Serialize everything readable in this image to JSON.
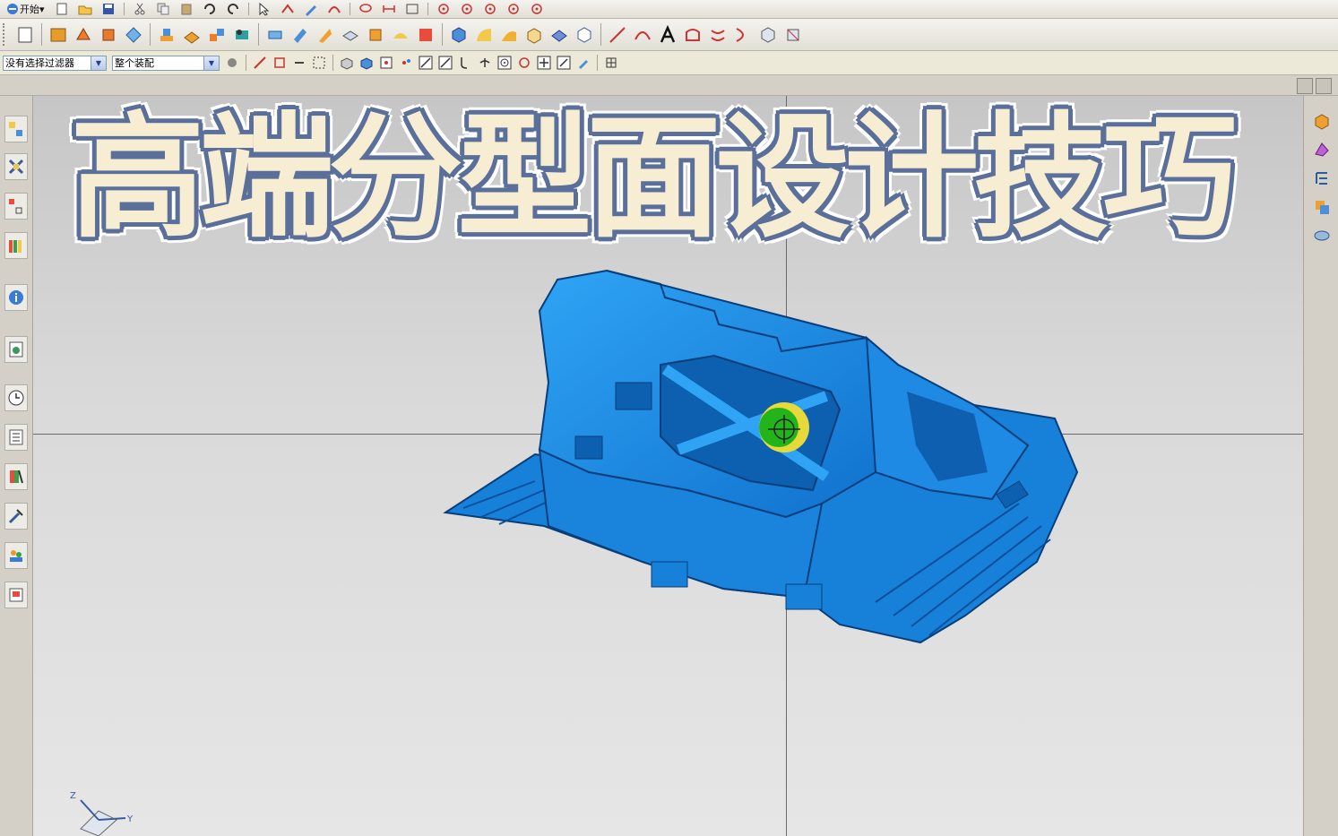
{
  "toolbar": {
    "start_label": "开始",
    "filter_select": {
      "value": "没有选择过滤器"
    },
    "assembly_select": {
      "value": "整个装配"
    }
  },
  "banner": {
    "title": "高端分型面设计技巧"
  },
  "triad": {
    "z_label": "Z",
    "y_label": "Y"
  },
  "icons": {
    "row1": [
      "start-menu-icon",
      "new-file-icon",
      "open-folder-icon",
      "save-icon",
      "cut-icon",
      "copy-icon",
      "paste-icon",
      "undo-icon",
      "redo-icon",
      "select-arrow-icon",
      "snap-icon",
      "pen-icon",
      "curve-icon",
      "lasso-icon",
      "dimension-icon",
      "sketch-icon",
      "circle-point-icon"
    ],
    "row2": [
      "new-part-icon",
      "book-icon",
      "extrude-icon",
      "shell-icon",
      "feature-icon",
      "blend-icon",
      "mold-wizard-icon",
      "trim-icon",
      "parting-icon",
      "layer-icon",
      "solid-icon",
      "block-icon",
      "curve-face-icon",
      "surface-icon",
      "cube-icon",
      "view-cube-icon",
      "line-icon",
      "arc-icon",
      "text-icon",
      "spline-icon",
      "offset-icon",
      "mirror-icon",
      "project-icon",
      "isometric-icon"
    ],
    "row3": [
      "filter-icon",
      "snap-end-icon",
      "snap-mid-icon",
      "snap-center-icon",
      "rect-select-icon",
      "box-icon",
      "solid-view-icon",
      "point-icon",
      "line-snap-icon",
      "perpendicular-icon",
      "tangent-icon",
      "circle-snap-icon",
      "quadrant-icon",
      "plus-snap-icon",
      "slash-snap-icon",
      "camera-icon",
      "grid-icon"
    ],
    "left": [
      "assembly-navigator-icon",
      "constraint-icon",
      "part-navigator-icon",
      "library-icon",
      "info-icon",
      "web-browser-icon",
      "history-icon",
      "layer-list-icon",
      "color-palette-icon",
      "tools-icon",
      "roles-icon",
      "system-icon"
    ],
    "right": [
      "mold-tools-icon",
      "parting-tool-icon",
      "list-tool-icon",
      "core-cavity-icon",
      "cylinder-icon"
    ]
  },
  "colors": {
    "model_blue": "#1a8fe8",
    "model_dark": "#0d5fb0",
    "title_fill": "#f7edd2",
    "title_outline": "#5a6f99",
    "cursor_green": "#22b41a",
    "cursor_yellow": "#e8d93a"
  }
}
